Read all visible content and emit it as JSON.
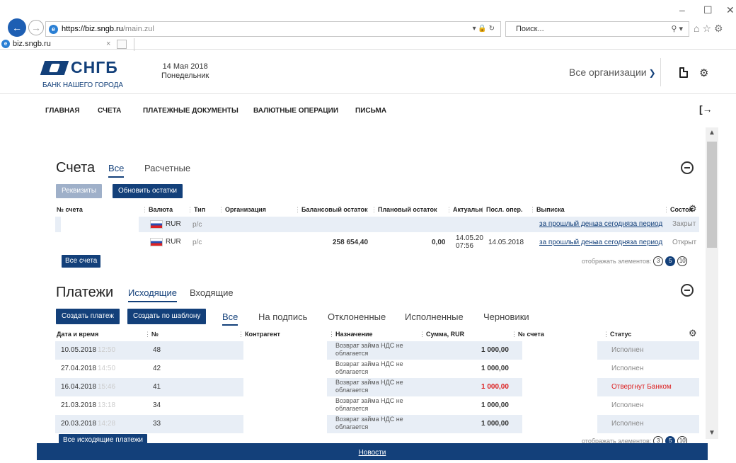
{
  "browser": {
    "url_host": "https://biz.sngb.ru",
    "url_path": "/main.zul",
    "search_placeholder": "Поиск...",
    "tab_title": "biz.sngb.ru"
  },
  "header": {
    "logo_text": "СНГБ",
    "logo_sub": "БАНК НАШЕГО ГОРОДА",
    "date": "14 Мая 2018",
    "weekday": "Понедельник",
    "orgs_label": "Все организации"
  },
  "menu": [
    "ГЛАВНАЯ",
    "СЧЕТА",
    "ПЛАТЕЖНЫЕ ДОКУМЕНТЫ",
    "ВАЛЮТНЫЕ ОПЕРАЦИИ",
    "ПИСЬМА"
  ],
  "accounts": {
    "title": "Счета",
    "tabs": [
      "Все",
      "Расчетные"
    ],
    "btn_requisites": "Реквизиты",
    "btn_refresh": "Обновить остатки",
    "columns": [
      "№ счета",
      "Валюта",
      "Тип",
      "Организация",
      "Балансовый остаток",
      "Плановый остаток",
      "Актуальн",
      "Посл. опер.",
      "Выписка",
      "Состоя"
    ],
    "rows": [
      {
        "currency": "RUR",
        "type": "р/с",
        "balance": "",
        "planned": "",
        "actual_date": "",
        "actual_time": "",
        "last_op": "",
        "stmt_prev": "за прошлый день",
        "stmt_today": "за сегодня",
        "stmt_period": "за период",
        "status": "Закрыт"
      },
      {
        "currency": "RUR",
        "type": "р/с",
        "balance": "258 654,40",
        "planned": "0,00",
        "actual_date": "14.05.20",
        "actual_time": "07:56",
        "last_op": "14.05.2018",
        "stmt_prev": "за прошлый день",
        "stmt_today": "за сегодня",
        "stmt_period": "за период",
        "status": "Открыт"
      }
    ],
    "btn_all": "Все счета",
    "pager_label": "отображать элементов:",
    "pager": [
      "3",
      "5",
      "10"
    ]
  },
  "payments": {
    "title": "Платежи",
    "tabs": [
      "Исходящие",
      "Входящие"
    ],
    "btn_create": "Создать платеж",
    "btn_template": "Создать по шаблону",
    "filters": [
      "Все",
      "На подпись",
      "Отклоненные",
      "Исполненные",
      "Черновики"
    ],
    "columns": [
      "Дата и время",
      "№",
      "Контрагент",
      "Назначение",
      "Сумма, RUR",
      "№ счета",
      "Статус"
    ],
    "rows": [
      {
        "date": "10.05.2018",
        "time": "12:50",
        "num": "48",
        "purpose1": "Возврат займа НДС не",
        "purpose2": "облагается",
        "sum": "1 000,00",
        "status": "Исполнен"
      },
      {
        "date": "27.04.2018",
        "time": "14:50",
        "num": "42",
        "purpose1": "Возврат займа НДС не",
        "purpose2": "облагается",
        "sum": "1 000,00",
        "status": "Исполнен"
      },
      {
        "date": "16.04.2018",
        "time": "15:46",
        "num": "41",
        "purpose1": "Возврат займа НДС не",
        "purpose2": "облагается",
        "sum": "1 000,00",
        "status": "Отвергнут Банком"
      },
      {
        "date": "21.03.2018",
        "time": "13:18",
        "num": "34",
        "purpose1": "Возврат займа НДС не",
        "purpose2": "облагается",
        "sum": "1 000,00",
        "status": "Исполнен"
      },
      {
        "date": "20.03.2018",
        "time": "14:28",
        "num": "33",
        "purpose1": "Возврат займа НДС не",
        "purpose2": "облагается",
        "sum": "1 000,00",
        "status": "Исполнен"
      }
    ],
    "btn_all": "Все исходящие платежи",
    "pager_label": "отображать элементов:",
    "pager": [
      "3",
      "5",
      "10"
    ]
  },
  "footer": {
    "news": "Новости"
  },
  "colors": {
    "brand": "#13407a",
    "row_alt": "#e8eef6",
    "rejected": "#dd2222"
  }
}
